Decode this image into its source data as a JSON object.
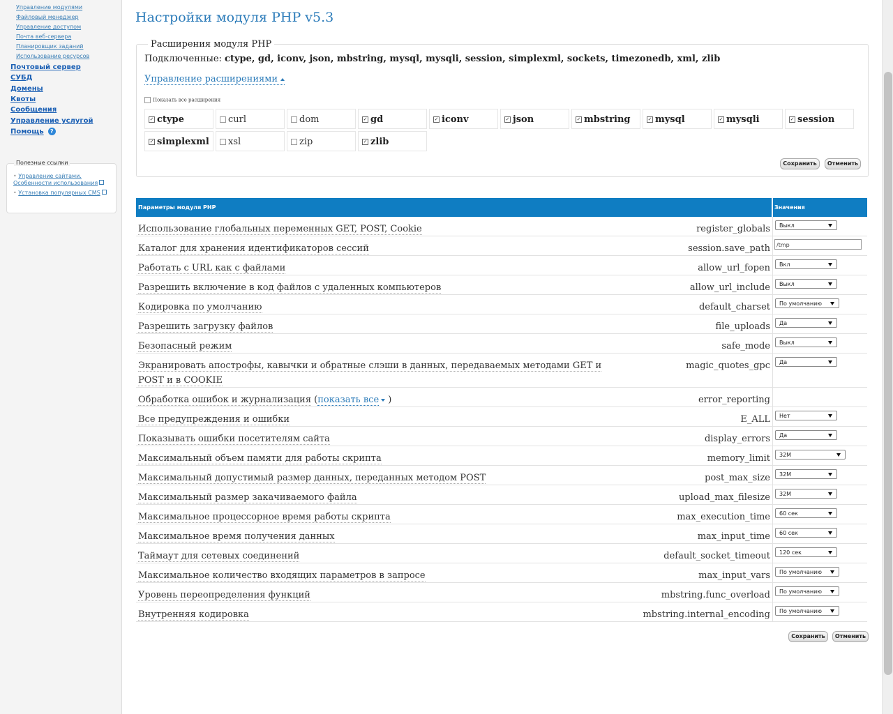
{
  "sidebar": {
    "sub_links": [
      "Управление модулями",
      "Файловый менеджер",
      "Управление доступом",
      "Почта веб-сервера",
      "Планировщик заданий",
      "Использование ресурсов"
    ],
    "main_links": [
      "Почтовый сервер",
      "СУБД",
      "Домены",
      "Квоты",
      "Сообщения",
      "Управление услугой",
      "Помощь"
    ],
    "help_icon": "?",
    "useful_title": "Полезные ссылки",
    "useful_links": [
      "Управление сайтами. Особенности использования",
      "Установка популярных CMS"
    ]
  },
  "page": {
    "title": "Настройки модуля PHP v5.3"
  },
  "extensions": {
    "legend": "Расширения модуля PHP",
    "connected_label": "Подключенные:",
    "connected_list": "ctype, gd, iconv, json, mbstring, mysql, mysqli, session, simplexml, sockets, timezonedb, xml, zlib",
    "manage_link": "Управление расширениями",
    "show_all_label": "Показать все расширения",
    "items": [
      {
        "name": "ctype",
        "checked": true
      },
      {
        "name": "curl",
        "checked": false
      },
      {
        "name": "dom",
        "checked": false
      },
      {
        "name": "gd",
        "checked": true
      },
      {
        "name": "iconv",
        "checked": true
      },
      {
        "name": "json",
        "checked": true
      },
      {
        "name": "mbstring",
        "checked": true
      },
      {
        "name": "mysql",
        "checked": true
      },
      {
        "name": "mysqli",
        "checked": true
      },
      {
        "name": "session",
        "checked": true
      },
      {
        "name": "simplexml",
        "checked": true
      },
      {
        "name": "xsl",
        "checked": false
      },
      {
        "name": "zip",
        "checked": false
      },
      {
        "name": "zlib",
        "checked": true
      }
    ],
    "save_label": "Сохранить",
    "cancel_label": "Отменить"
  },
  "params": {
    "header_params": "Параметры модуля PHP",
    "header_values": "Значения",
    "rows": [
      {
        "label": "Использование глобальных переменных GET, POST, Cookie",
        "name": "register_globals",
        "value": "Выкл",
        "type": "select"
      },
      {
        "label": "Каталог для хранения идентификаторов сессий",
        "name": "session.save_path",
        "value": "/tmp",
        "type": "input"
      },
      {
        "label": "Работать с URL как с файлами",
        "name": "allow_url_fopen",
        "value": "Вкл",
        "type": "select"
      },
      {
        "label": "Разрешить включение в код файлов с удаленных компьютеров",
        "name": "allow_url_include",
        "value": "Выкл",
        "type": "select"
      },
      {
        "label": "Кодировка по умолчанию",
        "name": "default_charset",
        "value": "По умолчанию",
        "type": "select"
      },
      {
        "label": "Разрешить загрузку файлов",
        "name": "file_uploads",
        "value": "Да",
        "type": "select"
      },
      {
        "label": "Безопасный режим",
        "name": "safe_mode",
        "value": "Выкл",
        "type": "select"
      },
      {
        "label": "Экранировать апострофы, кавычки и обратные слэши в данных, передаваемых методами GET и POST и в COOKIE",
        "name": "magic_quotes_gpc",
        "value": "Да",
        "type": "select"
      },
      {
        "label": "Обработка ошибок и журнализация",
        "name": "error_reporting",
        "type": "group",
        "link": "показать все"
      },
      {
        "label": "Все предупреждения и ошибки",
        "name": "E_ALL",
        "value": "Нет",
        "type": "select"
      },
      {
        "label": "Показывать ошибки посетителям сайта",
        "name": "display_errors",
        "value": "Да",
        "type": "select"
      },
      {
        "label": "Максимальный объем памяти для работы скрипта",
        "name": "memory_limit",
        "value": "32M",
        "type": "select"
      },
      {
        "label": "Максимальный допустимый размер данных, переданных методом POST",
        "name": "post_max_size",
        "value": "32M",
        "type": "select"
      },
      {
        "label": "Максимальный размер закачиваемого файла",
        "name": "upload_max_filesize",
        "value": "32M",
        "type": "select"
      },
      {
        "label": "Максимальное процессорное время работы скрипта",
        "name": "max_execution_time",
        "value": "60 сек",
        "type": "select"
      },
      {
        "label": "Максимальное время получения данных",
        "name": "max_input_time",
        "value": "60 сек",
        "type": "select"
      },
      {
        "label": "Таймаут для сетевых соединений",
        "name": "default_socket_timeout",
        "value": "120 сек",
        "type": "select"
      },
      {
        "label": "Максимальное количество входящих параметров в запросе",
        "name": "max_input_vars",
        "value": "По умолчанию",
        "type": "select"
      },
      {
        "label": "Уровень переопределения функций",
        "name": "mbstring.func_overload",
        "value": "По умолчанию",
        "type": "select"
      },
      {
        "label": "Внутренняя кодировка",
        "name": "mbstring.internal_encoding",
        "value": "По умолчанию",
        "type": "select"
      }
    ],
    "save_label": "Сохранить",
    "cancel_label": "Отменить"
  }
}
